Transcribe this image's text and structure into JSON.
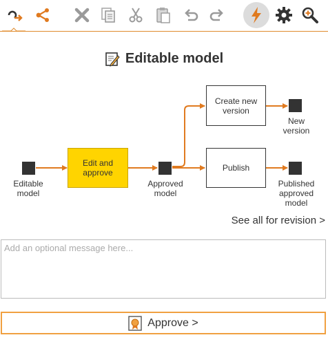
{
  "toolbar": {
    "icons": [
      "link-icon",
      "share-icon",
      "delete-icon",
      "copy-icon",
      "cut-icon",
      "paste-icon",
      "undo-icon",
      "redo-icon",
      "lightning-icon",
      "gear-icon",
      "zoom-icon"
    ]
  },
  "title": "Editable model",
  "diagram": {
    "nodes": {
      "editable_model": "Editable\nmodel",
      "edit_and_approve": "Edit and\napprove",
      "approved_model": "Approved\nmodel",
      "create_new_version": "Create new\nversion",
      "new_version": "New\nversion",
      "publish": "Publish",
      "published_approved_model": "Published\napproved\nmodel"
    }
  },
  "see_all": "See all for revision >",
  "message": {
    "placeholder": "Add an optional message here..."
  },
  "approve": {
    "label": "Approve >"
  },
  "colors": {
    "accent": "#e07a1f",
    "highlight": "#ffd400",
    "border": "#f0a040"
  }
}
